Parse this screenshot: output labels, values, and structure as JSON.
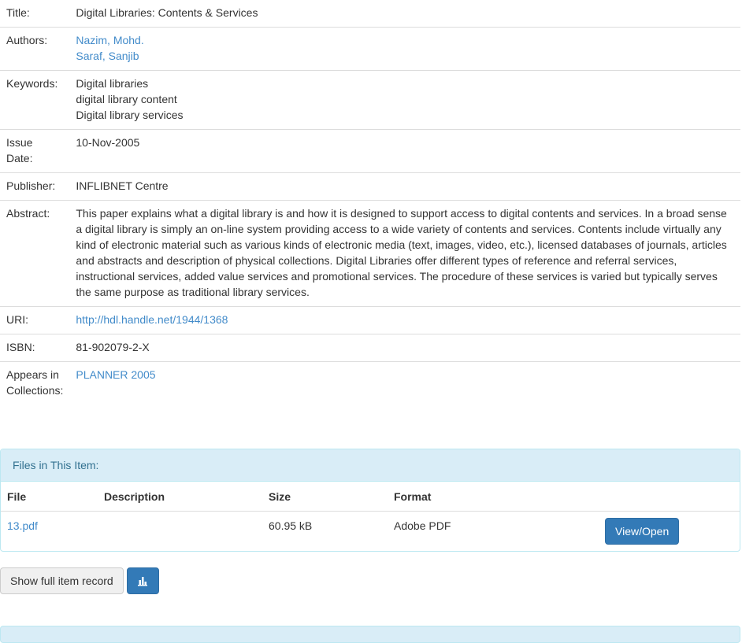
{
  "metadata": {
    "title": {
      "label": "Title:",
      "value": "Digital Libraries: Contents & Services"
    },
    "authors": {
      "label": "Authors:",
      "values": [
        "Nazim, Mohd.",
        "Saraf, Sanjib"
      ]
    },
    "keywords": {
      "label": "Keywords:",
      "values": [
        "Digital libraries",
        "digital library content",
        "Digital library services"
      ]
    },
    "issue_date": {
      "label_line1": "Issue",
      "label_line2": "Date:",
      "value": "10-Nov-2005"
    },
    "publisher": {
      "label": "Publisher:",
      "value": "INFLIBNET Centre"
    },
    "abstract": {
      "label": "Abstract:",
      "value": "This paper explains what a digital library is and how it is designed to support access to digital contents and services. In a broad sense a digital library is simply an on-line system providing access to a wide variety of contents and services. Contents include virtually any kind of electronic material such as various kinds of electronic media (text, images, video, etc.), licensed databases of journals, articles and abstracts and description of physical collections. Digital Libraries offer different types of reference and referral services, instructional services, added value services and promotional services. The procedure of these services is varied but typically serves the same purpose as traditional library services."
    },
    "uri": {
      "label": "URI:",
      "value": "http://hdl.handle.net/1944/1368"
    },
    "isbn": {
      "label": "ISBN:",
      "value": "81-902079-2-X"
    },
    "collections": {
      "label_line1": "Appears in",
      "label_line2": "Collections:",
      "value": "PLANNER 2005"
    }
  },
  "files_panel": {
    "heading": "Files in This Item:",
    "columns": [
      "File",
      "Description",
      "Size",
      "Format"
    ],
    "rows": [
      {
        "file": "13.pdf",
        "description": "",
        "size": "60.95 kB",
        "format": "Adobe PDF",
        "action": "View/Open"
      }
    ]
  },
  "actions": {
    "show_full_record": "Show full item record",
    "stats_icon": "bar-chart-icon"
  },
  "colors": {
    "link": "#428bca",
    "primary": "#337ab7",
    "panel_heading_bg": "#d9edf7",
    "panel_heading_text": "#31708f"
  }
}
